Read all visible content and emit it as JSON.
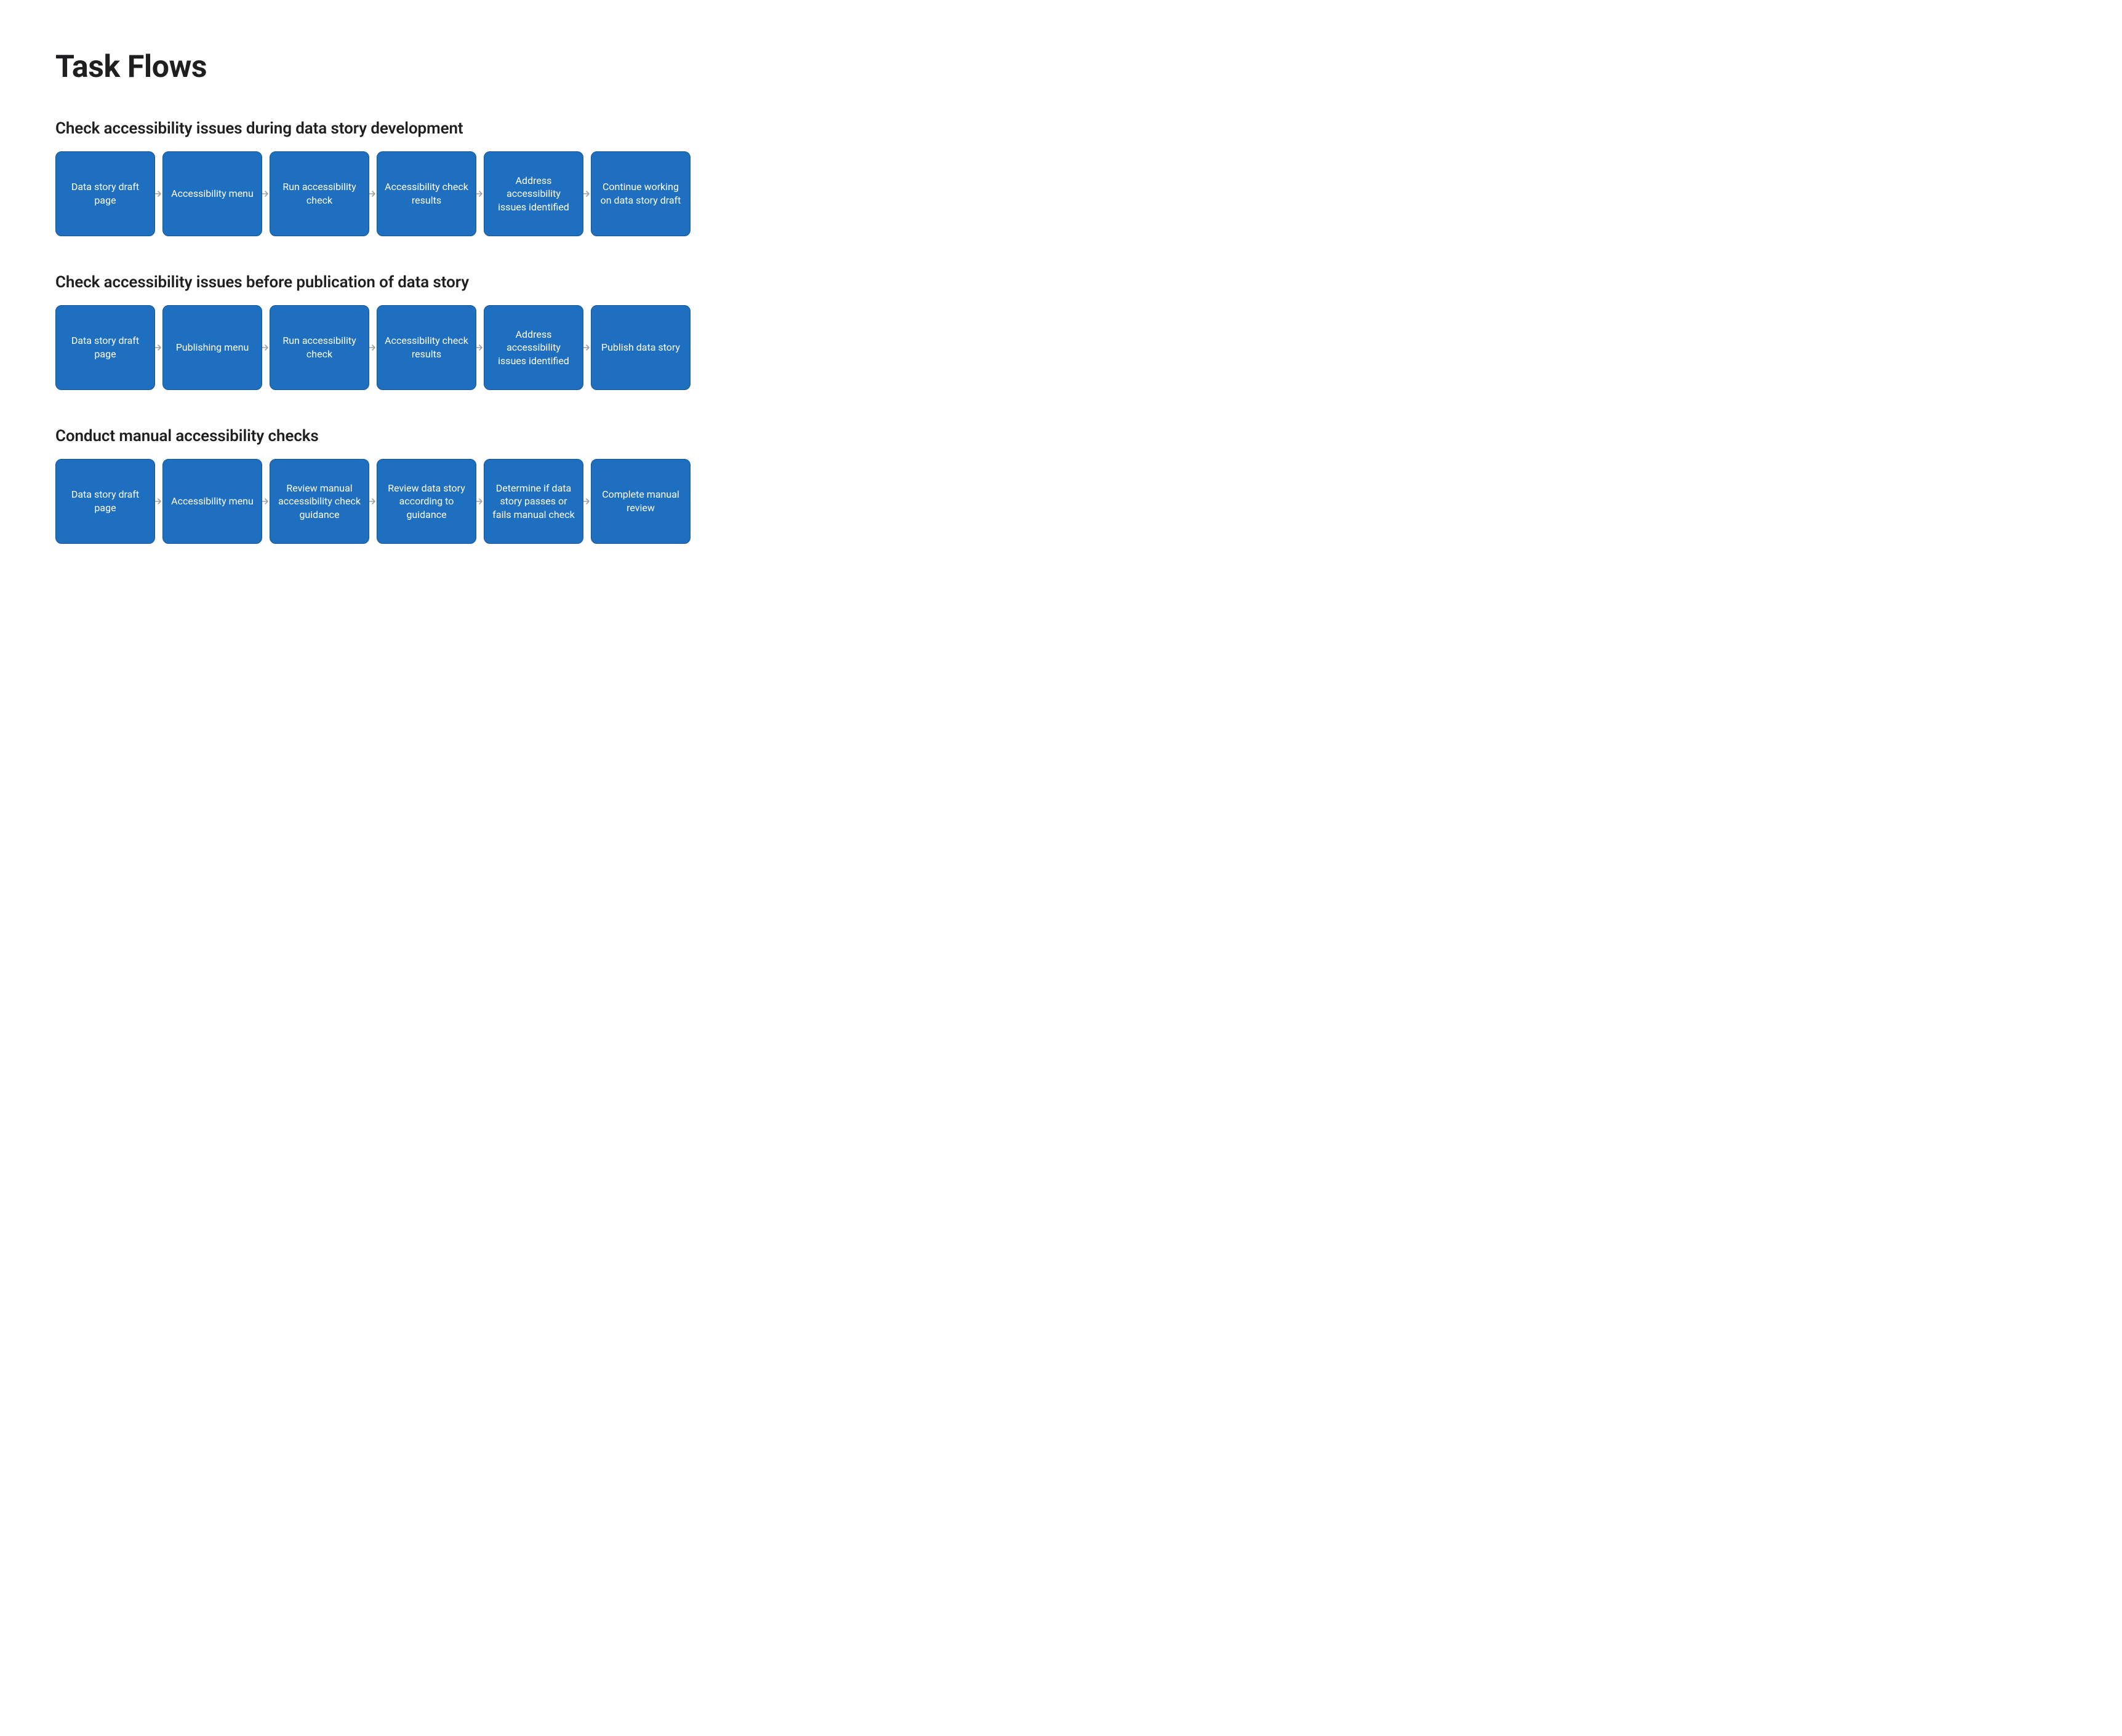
{
  "page_title": "Task Flows",
  "flows": [
    {
      "title": "Check accessibility issues during data story development",
      "steps": [
        "Data story draft page",
        "Accessibility menu",
        "Run accessibility check",
        "Accessibility check results",
        "Address accessibility issues identified",
        "Continue working on data story draft"
      ]
    },
    {
      "title": "Check accessibility issues before publication of data story",
      "steps": [
        "Data story draft page",
        "Publishing menu",
        "Run accessibility check",
        "Accessibility check results",
        "Address accessibility issues identified",
        "Publish data story"
      ]
    },
    {
      "title": "Conduct manual accessibility checks",
      "steps": [
        "Data story draft page",
        "Accessibility menu",
        "Review manual accessibility check guidance",
        "Review data story according to guidance",
        "Determine if data story passes or fails manual check",
        "Complete manual review"
      ]
    }
  ],
  "colors": {
    "box_fill": "#1f6fc1",
    "box_border": "#145491",
    "box_text": "#ffffff",
    "heading_text": "#1f1f22",
    "arrow": "#a0a0a8"
  }
}
